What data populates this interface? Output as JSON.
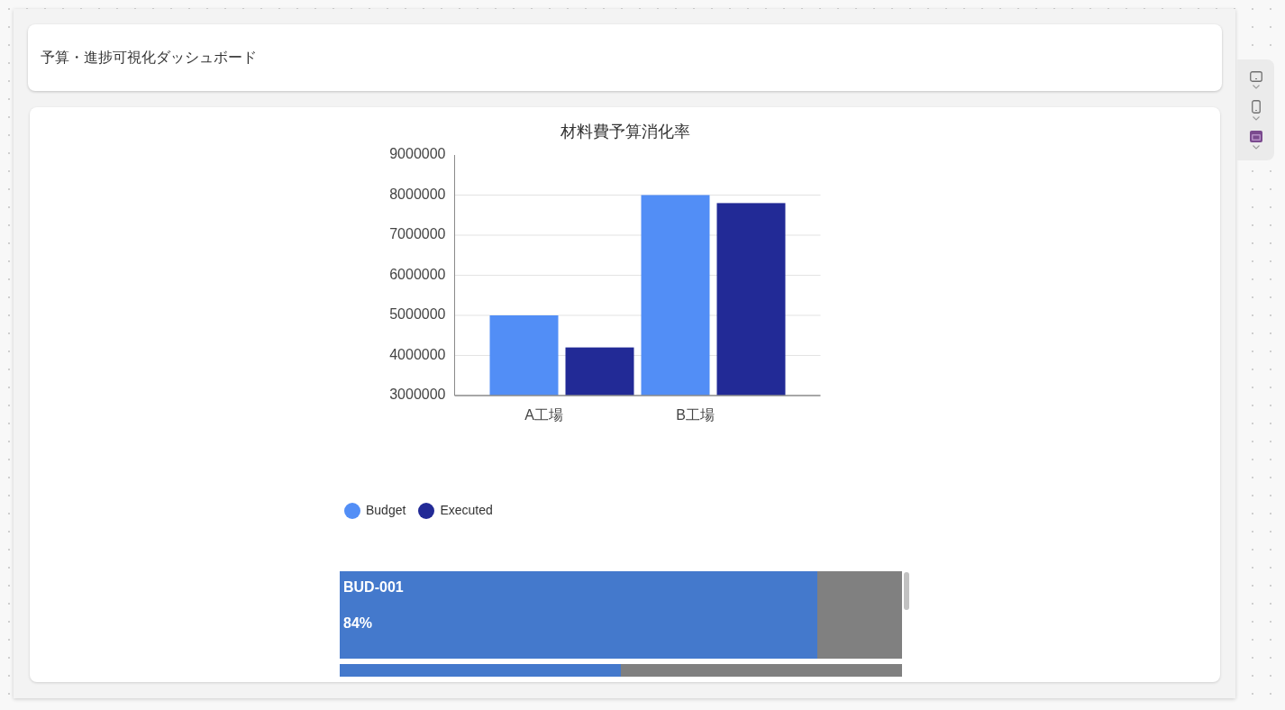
{
  "header": {
    "title": "予算・進捗可視化ダッシュボード"
  },
  "chart": {
    "chart_data": {
      "type": "bar",
      "title": "材料費予算消化率",
      "categories": [
        "A工場",
        "B工場"
      ],
      "series": [
        {
          "name": "Budget",
          "color": "#528ef6",
          "values": [
            5000000,
            8000000
          ]
        },
        {
          "name": "Executed",
          "color": "#222a96",
          "values": [
            4200000,
            7800000
          ]
        }
      ],
      "ylim": [
        3000000,
        9000000
      ],
      "yticks": [
        3000000,
        4000000,
        5000000,
        6000000,
        7000000,
        8000000,
        9000000
      ],
      "grid": true
    }
  },
  "gallery": {
    "items": [
      {
        "label": "BUD-001",
        "value": "84%",
        "level": 0.85
      },
      {
        "level": 0.5
      }
    ]
  }
}
